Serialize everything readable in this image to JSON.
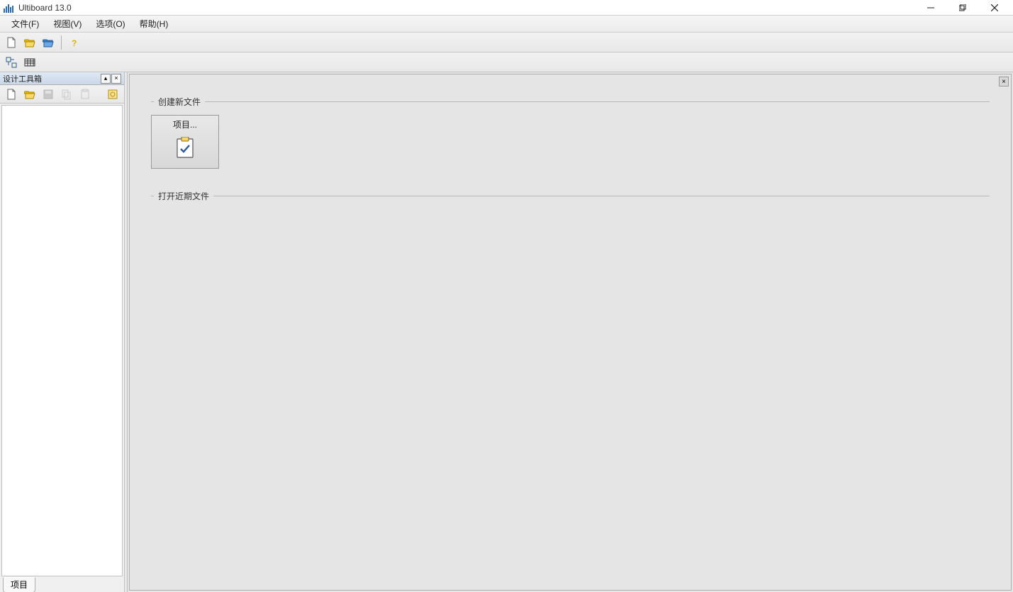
{
  "titlebar": {
    "title": "Ultiboard 13.0"
  },
  "menubar": {
    "items": [
      {
        "label": "文件(F)",
        "hotkey": "F"
      },
      {
        "label": "视图(V)",
        "hotkey": "V"
      },
      {
        "label": "选项(O)",
        "hotkey": "O"
      },
      {
        "label": "帮助(H)",
        "hotkey": "H"
      }
    ]
  },
  "sidebar": {
    "title": "设计工具箱",
    "tab": "项目"
  },
  "workspace": {
    "create_section": "创建新文件",
    "recent_section": "打开近期文件",
    "project_card": "项目..."
  }
}
